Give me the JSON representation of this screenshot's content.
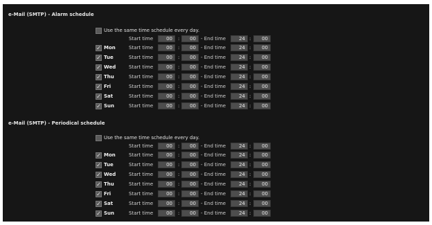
{
  "sections": [
    {
      "title": "e-Mail (SMTP) - Alarm schedule",
      "same_schedule_label": "Use the same time schedule every day.",
      "all_days": {
        "start_label": "Start time",
        "start_hour": "00",
        "start_min": "00",
        "end_label": "- End time",
        "end_hour": "24",
        "end_min": "00"
      },
      "days": [
        {
          "name": "Mon",
          "checked": true,
          "start_label": "Start time",
          "start_hour": "00",
          "start_min": "00",
          "end_label": "- End time",
          "end_hour": "24",
          "end_min": "00"
        },
        {
          "name": "Tue",
          "checked": true,
          "start_label": "Start time",
          "start_hour": "00",
          "start_min": "00",
          "end_label": "- End time",
          "end_hour": "24",
          "end_min": "00"
        },
        {
          "name": "Wed",
          "checked": true,
          "start_label": "Start time",
          "start_hour": "00",
          "start_min": "00",
          "end_label": "- End time",
          "end_hour": "24",
          "end_min": "00"
        },
        {
          "name": "Thu",
          "checked": true,
          "start_label": "Start time",
          "start_hour": "00",
          "start_min": "00",
          "end_label": "- End time",
          "end_hour": "24",
          "end_min": "00"
        },
        {
          "name": "Fri",
          "checked": true,
          "start_label": "Start time",
          "start_hour": "00",
          "start_min": "00",
          "end_label": "- End time",
          "end_hour": "24",
          "end_min": "00"
        },
        {
          "name": "Sat",
          "checked": true,
          "start_label": "Start time",
          "start_hour": "00",
          "start_min": "00",
          "end_label": "- End time",
          "end_hour": "24",
          "end_min": "00"
        },
        {
          "name": "Sun",
          "checked": true,
          "start_label": "Start time",
          "start_hour": "00",
          "start_min": "00",
          "end_label": "- End time",
          "end_hour": "24",
          "end_min": "00"
        }
      ]
    },
    {
      "title": "e-Mail (SMTP) - Periodical schedule",
      "same_schedule_label": "Use the same time schedule every day.",
      "all_days": {
        "start_label": "Start time",
        "start_hour": "00",
        "start_min": "00",
        "end_label": "- End time",
        "end_hour": "24",
        "end_min": "00"
      },
      "days": [
        {
          "name": "Mon",
          "checked": true,
          "start_label": "Start time",
          "start_hour": "00",
          "start_min": "00",
          "end_label": "- End time",
          "end_hour": "24",
          "end_min": "00"
        },
        {
          "name": "Tue",
          "checked": true,
          "start_label": "Start time",
          "start_hour": "00",
          "start_min": "00",
          "end_label": "- End time",
          "end_hour": "24",
          "end_min": "00"
        },
        {
          "name": "Wed",
          "checked": true,
          "start_label": "Start time",
          "start_hour": "00",
          "start_min": "00",
          "end_label": "- End time",
          "end_hour": "24",
          "end_min": "00"
        },
        {
          "name": "Thu",
          "checked": true,
          "start_label": "Start time",
          "start_hour": "00",
          "start_min": "00",
          "end_label": "- End time",
          "end_hour": "24",
          "end_min": "00"
        },
        {
          "name": "Fri",
          "checked": true,
          "start_label": "Start time",
          "start_hour": "00",
          "start_min": "00",
          "end_label": "- End time",
          "end_hour": "24",
          "end_min": "00"
        },
        {
          "name": "Sat",
          "checked": true,
          "start_label": "Start time",
          "start_hour": "00",
          "start_min": "00",
          "end_label": "- End time",
          "end_hour": "24",
          "end_min": "00"
        },
        {
          "name": "Sun",
          "checked": true,
          "start_label": "Start time",
          "start_hour": "00",
          "start_min": "00",
          "end_label": "- End time",
          "end_hour": "24",
          "end_min": "00"
        }
      ]
    }
  ]
}
